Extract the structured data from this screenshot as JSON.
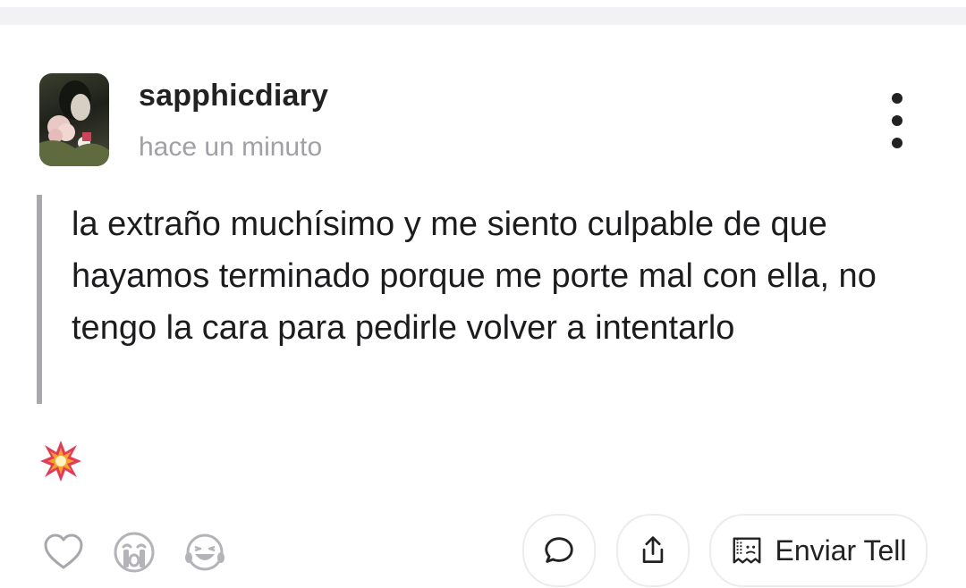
{
  "post": {
    "username": "sapphicdiary",
    "time": "hace un minuto",
    "text": "la extraño muchísimo y me siento culpable de que hayamos terminado porque me porte mal con ella, no tengo la cara para pedirle volver a intentarlo"
  },
  "reactions": [
    {
      "name": "collision-emoji",
      "glyph": "💥"
    }
  ],
  "actions": {
    "send_label": "Enviar Tell",
    "icons": [
      "heart-icon",
      "crying-face-icon",
      "laughing-face-icon",
      "comment-icon",
      "share-icon",
      "tell-envelope-icon"
    ]
  },
  "colors": {
    "text": "#1c1c1e",
    "muted": "#a0a0a6",
    "quote_bar": "#a9a9ad",
    "border": "#ececef"
  }
}
